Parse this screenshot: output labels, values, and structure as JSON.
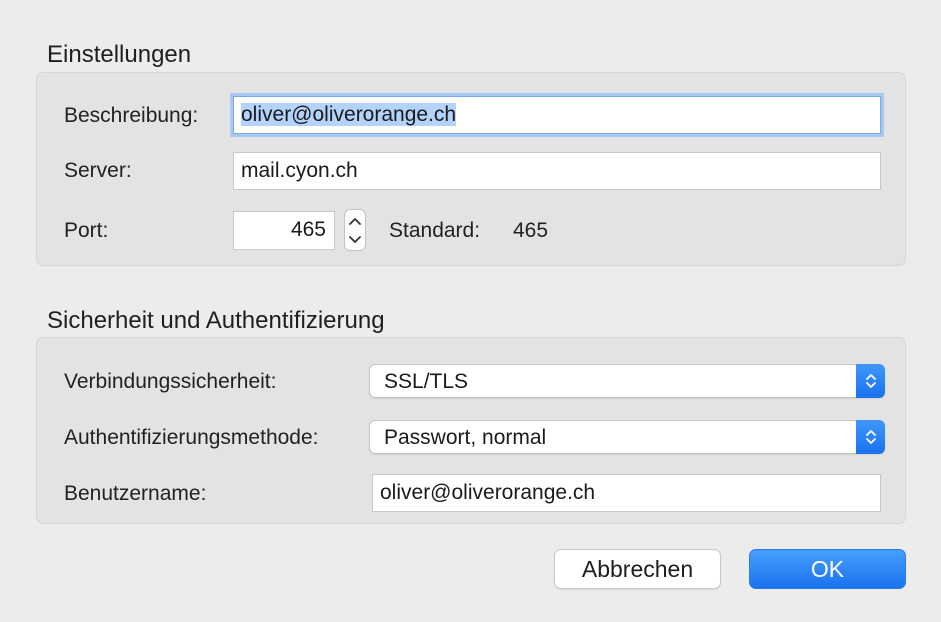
{
  "settings": {
    "title": "Einstellungen",
    "description_label": "Beschreibung:",
    "description_value": "oliver@oliverorange.ch",
    "server_label": "Server:",
    "server_value": "mail.cyon.ch",
    "port_label": "Port:",
    "port_value": "465",
    "standard_label": "Standard:",
    "standard_value": "465"
  },
  "security": {
    "title": "Sicherheit und Authentifizierung",
    "connection_label": "Verbindungssicherheit:",
    "connection_value": "SSL/TLS",
    "auth_label": "Authentifizierungsmethode:",
    "auth_value": "Passwort, normal",
    "username_label": "Benutzername:",
    "username_value": "oliver@oliverorange.ch"
  },
  "buttons": {
    "cancel_label": "Abbrechen",
    "ok_label": "OK"
  },
  "colors": {
    "accent": "#1b72f0",
    "selection": "#b4d3fb",
    "focus_ring": "#a7c8f3",
    "window_bg": "#ececec",
    "group_bg": "#e3e3e3"
  }
}
